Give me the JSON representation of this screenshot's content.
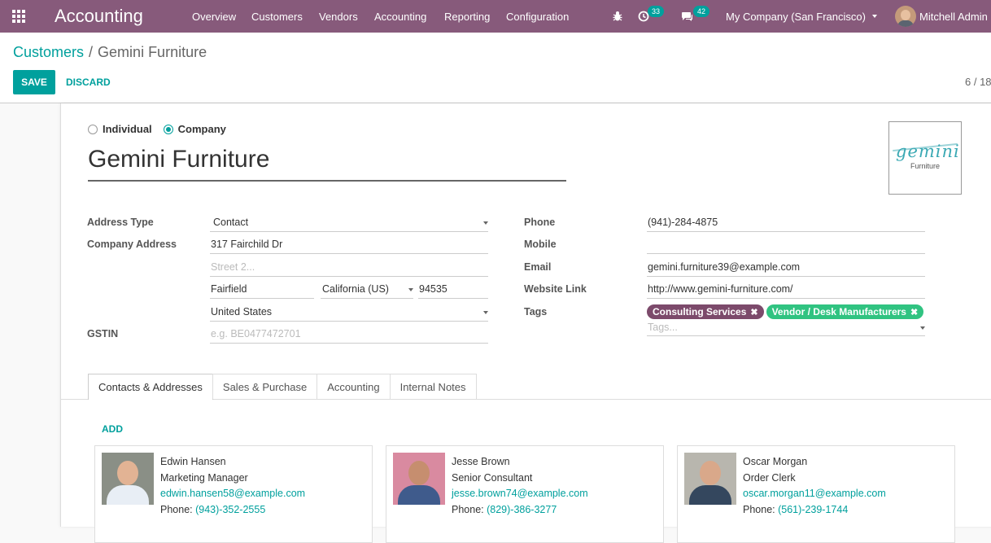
{
  "navbar": {
    "app_title": "Accounting",
    "menu": [
      "Overview",
      "Customers",
      "Vendors",
      "Accounting",
      "Reporting",
      "Configuration"
    ],
    "activity_count": "33",
    "message_count": "42",
    "company": "My Company (San Francisco)",
    "user": "Mitchell Admin"
  },
  "breadcrumb": {
    "parent": "Customers",
    "separator": "/",
    "current": "Gemini Furniture"
  },
  "actions": {
    "save": "SAVE",
    "discard": "DISCARD"
  },
  "pager": "6 / 18",
  "partner": {
    "type_options": {
      "individual": "Individual",
      "company": "Company",
      "selected": "Company"
    },
    "name": "Gemini Furniture",
    "logo": {
      "word": "gemini",
      "sub": "Furniture"
    }
  },
  "address": {
    "address_type_label": "Address Type",
    "address_type": "Contact",
    "company_address_label": "Company Address",
    "street": "317 Fairchild Dr",
    "street2_placeholder": "Street 2...",
    "city": "Fairfield",
    "state": "California (US)",
    "zip": "94535",
    "country": "United States",
    "gstin_label": "GSTIN",
    "gstin_placeholder": "e.g. BE0477472701"
  },
  "contact_info": {
    "phone_label": "Phone",
    "phone": "(941)-284-4875",
    "mobile_label": "Mobile",
    "mobile": "",
    "email_label": "Email",
    "email": "gemini.furniture39@example.com",
    "website_label": "Website Link",
    "website": "http://www.gemini-furniture.com/",
    "tags_label": "Tags",
    "tags": [
      {
        "label": "Consulting Services",
        "color": "#7c4a6b"
      },
      {
        "label": "Vendor / Desk Manufacturers",
        "color": "#30c381"
      }
    ],
    "tags_placeholder": "Tags..."
  },
  "tabs": [
    "Contacts & Addresses",
    "Sales & Purchase",
    "Accounting",
    "Internal Notes"
  ],
  "contacts": {
    "add_label": "ADD",
    "phone_prefix": "Phone:",
    "items": [
      {
        "name": "Edwin Hansen",
        "title": "Marketing Manager",
        "email": "edwin.hansen58@example.com",
        "phone": "(943)-352-2555"
      },
      {
        "name": "Jesse Brown",
        "title": "Senior Consultant",
        "email": "jesse.brown74@example.com",
        "phone": "(829)-386-3277"
      },
      {
        "name": "Oscar Morgan",
        "title": "Order Clerk",
        "email": "oscar.morgan11@example.com",
        "phone": "(561)-239-1744"
      }
    ]
  },
  "colors": {
    "navbar": "#875a7b",
    "accent": "#00a09d"
  }
}
